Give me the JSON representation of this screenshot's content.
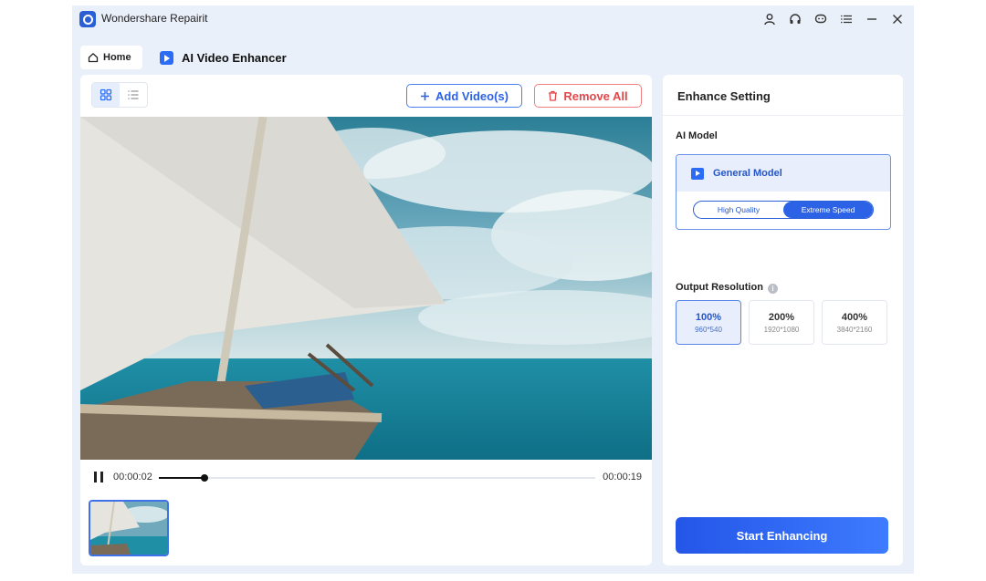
{
  "app": {
    "title": "Wondershare Repairit"
  },
  "window_icons": [
    "user-icon",
    "headset-icon",
    "chat-icon",
    "menu-icon",
    "minimize-icon",
    "close-icon"
  ],
  "nav": {
    "home_label": "Home",
    "current_label": "AI Video Enhancer"
  },
  "toolbar": {
    "add_label": "Add Video(s)",
    "remove_label": "Remove All"
  },
  "player": {
    "current_time": "00:00:02",
    "total_time": "00:00:19",
    "progress": 0.1053
  },
  "settings": {
    "title": "Enhance Setting",
    "ai_model_label": "AI Model",
    "model_name": "General Model",
    "modes": [
      {
        "label": "High Quality",
        "active": false
      },
      {
        "label": "Extreme Speed",
        "active": true
      }
    ],
    "output_label": "Output Resolution",
    "resolutions": [
      {
        "pct": "100%",
        "dim": "960*540",
        "selected": true
      },
      {
        "pct": "200%",
        "dim": "1920*1080",
        "selected": false
      },
      {
        "pct": "400%",
        "dim": "3840*2160",
        "selected": false
      }
    ],
    "start_label": "Start Enhancing"
  },
  "colors": {
    "accent": "#2b62e6",
    "danger": "#e4474a",
    "background": "#eaf0fa"
  }
}
